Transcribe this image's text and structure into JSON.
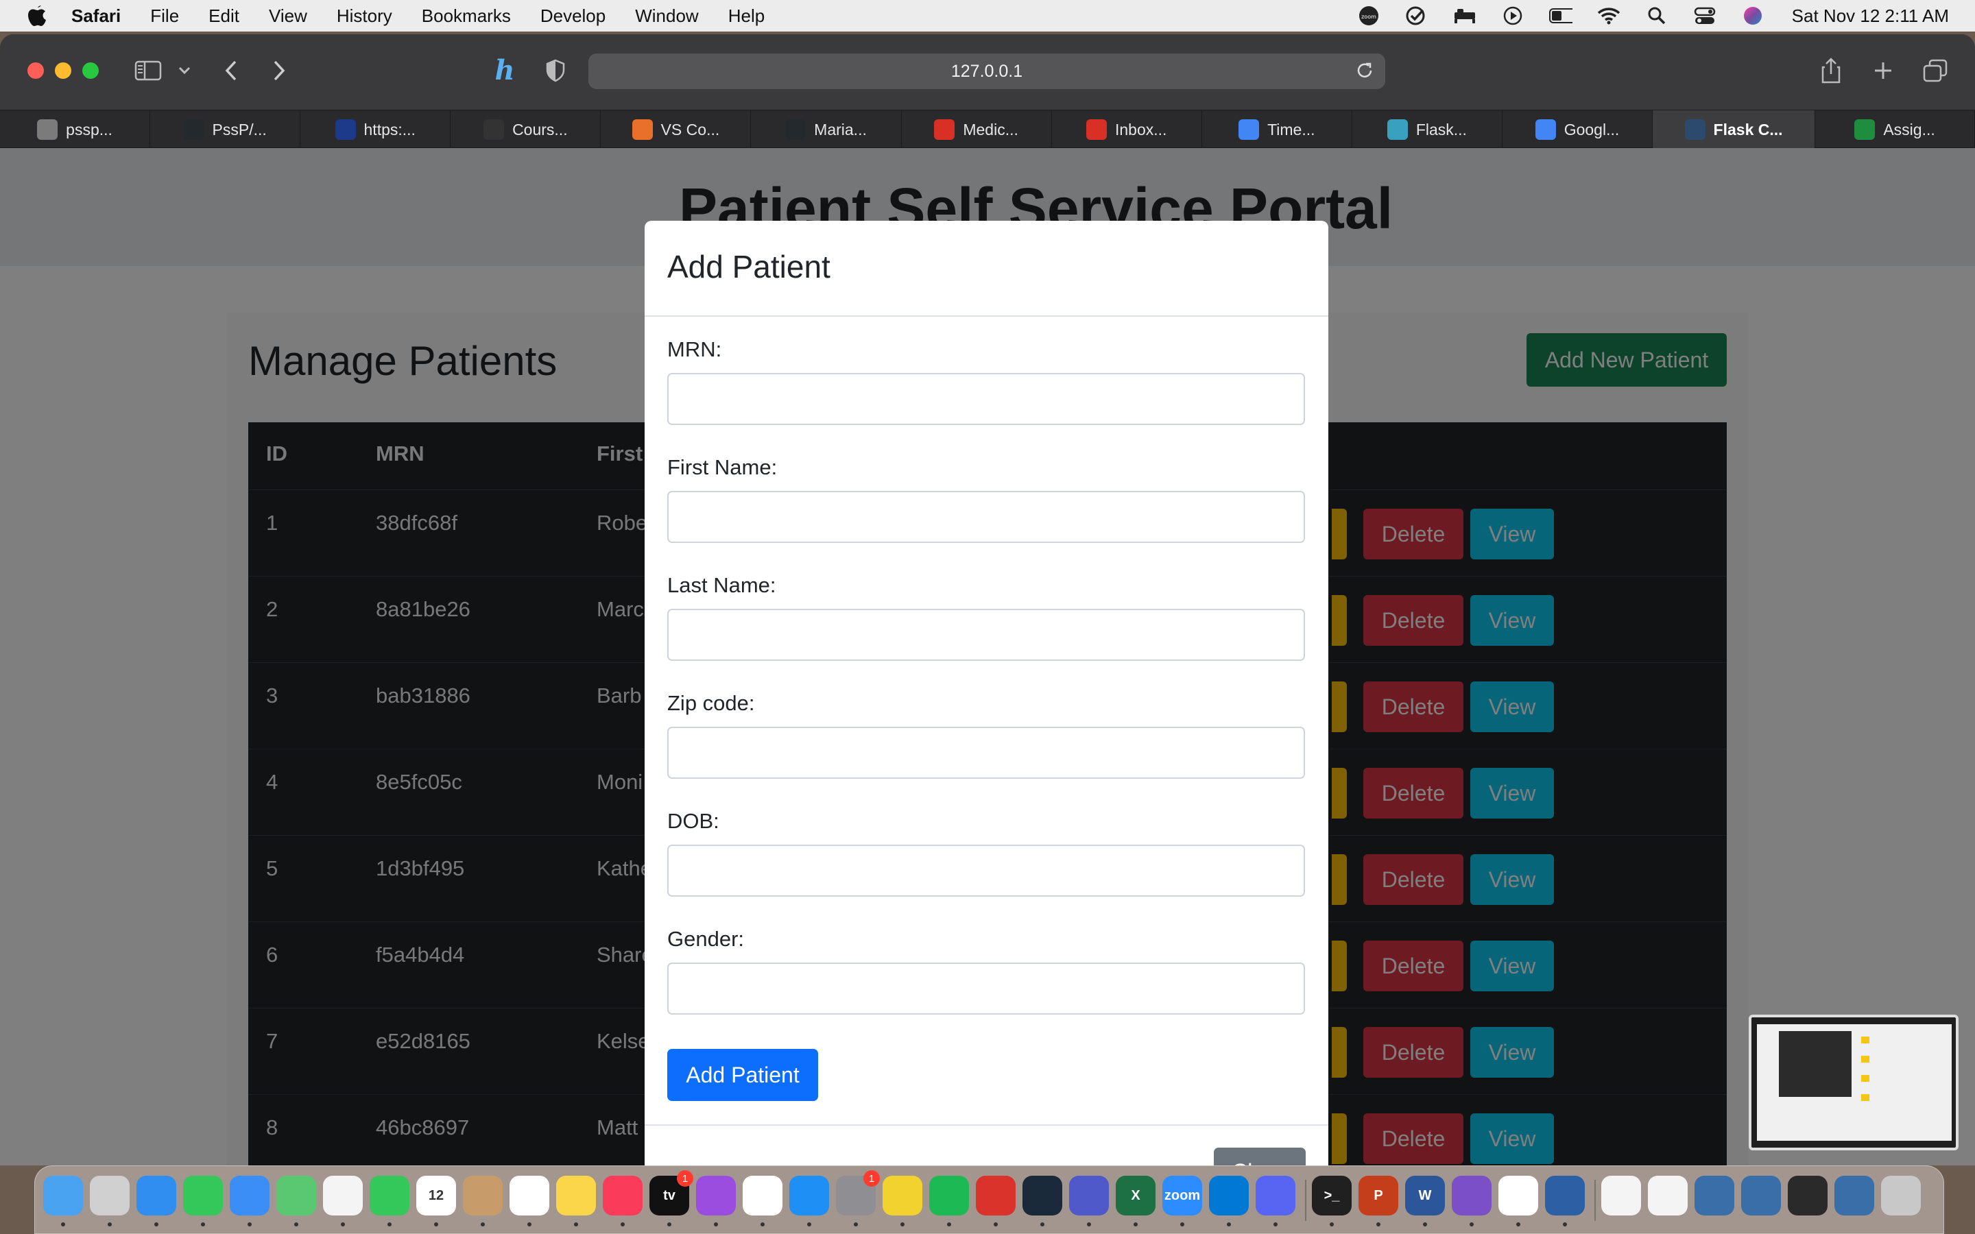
{
  "menubar": {
    "app_name": "Safari",
    "items": [
      "File",
      "Edit",
      "View",
      "History",
      "Bookmarks",
      "Develop",
      "Window",
      "Help"
    ],
    "clock": "Sat Nov 12  2:11 AM",
    "status_icons": [
      "zoom-icon",
      "checkmark-app-icon",
      "bed-icon",
      "play-circle-icon",
      "battery-icon",
      "wifi-icon",
      "search-icon",
      "control-center-icon",
      "siri-icon"
    ]
  },
  "browser": {
    "address": "127.0.0.1",
    "tabs": [
      {
        "label": "pssp...",
        "favicon": "chrome-icon",
        "color": "#7b7b7b"
      },
      {
        "label": "PssP/...",
        "favicon": "github-icon",
        "color": "#24292e"
      },
      {
        "label": "https:...",
        "favicon": "cuny-icon",
        "color": "#1d3a8a"
      },
      {
        "label": "Cours...",
        "favicon": "blackboard-icon",
        "color": "#333333"
      },
      {
        "label": "VS Co...",
        "favicon": "flame-icon",
        "color": "#e8702a"
      },
      {
        "label": "Maria...",
        "favicon": "github-icon",
        "color": "#24292e"
      },
      {
        "label": "Medic...",
        "favicon": "gmail-icon",
        "color": "#d93025"
      },
      {
        "label": "Inbox...",
        "favicon": "gmail-icon",
        "color": "#d93025"
      },
      {
        "label": "Time...",
        "favicon": "google-docs-icon",
        "color": "#4285f4"
      },
      {
        "label": "Flask...",
        "favicon": "flask-icon",
        "color": "#3aa0c0"
      },
      {
        "label": "Googl...",
        "favicon": "google-docs-icon",
        "color": "#4285f4"
      },
      {
        "label": "Flask C...",
        "favicon": "terminal-icon",
        "color": "#2c4a6e"
      },
      {
        "label": "Assig...",
        "favicon": "classroom-icon",
        "color": "#1e8e3e"
      }
    ],
    "active_tab_index": 11
  },
  "page": {
    "big_title": "Patient Self Service Portal",
    "manage_title": "Manage Patients",
    "add_new_label": "Add New Patient",
    "table": {
      "headers": [
        "ID",
        "MRN",
        "First"
      ],
      "rows": [
        {
          "id": "1",
          "mrn": "38dfc68f",
          "first": "Robe"
        },
        {
          "id": "2",
          "mrn": "8a81be26",
          "first": "Marc"
        },
        {
          "id": "3",
          "mrn": "bab31886",
          "first": "Barb"
        },
        {
          "id": "4",
          "mrn": "8e5fc05c",
          "first": "Moni"
        },
        {
          "id": "5",
          "mrn": "1d3bf495",
          "first": "Kathe"
        },
        {
          "id": "6",
          "mrn": "f5a4b4d4",
          "first": "Share"
        },
        {
          "id": "7",
          "mrn": "e52d8165",
          "first": "Kelse"
        },
        {
          "id": "8",
          "mrn": "46bc8697",
          "first": "Matt"
        }
      ],
      "delete_label": "Delete",
      "view_label": "View"
    }
  },
  "modal": {
    "title": "Add Patient",
    "fields": [
      {
        "label": "MRN:",
        "value": ""
      },
      {
        "label": "First Name:",
        "value": ""
      },
      {
        "label": "Last Name:",
        "value": ""
      },
      {
        "label": "Zip code:",
        "value": ""
      },
      {
        "label": "DOB:",
        "value": ""
      },
      {
        "label": "Gender:",
        "value": ""
      }
    ],
    "submit_label": "Add Patient",
    "close_label": "Close"
  },
  "dock": {
    "apps": [
      {
        "name": "finder-icon",
        "color": "#4aa3f0",
        "text": ""
      },
      {
        "name": "launchpad-icon",
        "color": "#d0d0d0",
        "text": ""
      },
      {
        "name": "safari-icon",
        "color": "#2f8ef0",
        "text": ""
      },
      {
        "name": "messages-icon",
        "color": "#34c759",
        "text": ""
      },
      {
        "name": "mail-icon",
        "color": "#3a8ef6",
        "text": ""
      },
      {
        "name": "maps-icon",
        "color": "#5ac870",
        "text": ""
      },
      {
        "name": "photos-icon",
        "color": "#f4f4f4",
        "text": ""
      },
      {
        "name": "facetime-icon",
        "color": "#34c759",
        "text": ""
      },
      {
        "name": "calendar-icon",
        "color": "#ffffff",
        "text": "12"
      },
      {
        "name": "contacts-icon",
        "color": "#c89c6a",
        "text": ""
      },
      {
        "name": "reminders-icon",
        "color": "#ffffff",
        "text": ""
      },
      {
        "name": "notes-icon",
        "color": "#fbd54a",
        "text": ""
      },
      {
        "name": "music-icon",
        "color": "#fa3c5a",
        "text": ""
      },
      {
        "name": "tv-icon",
        "color": "#111111",
        "text": "tv"
      },
      {
        "name": "podcasts-icon",
        "color": "#9b4de0",
        "text": ""
      },
      {
        "name": "news-icon",
        "color": "#ffffff",
        "text": ""
      },
      {
        "name": "app-store-icon",
        "color": "#1e90f5",
        "text": ""
      },
      {
        "name": "system-preferences-icon",
        "color": "#8e8e93",
        "text": ""
      },
      {
        "name": "todo-icon",
        "color": "#f2d22e",
        "text": ""
      },
      {
        "name": "spotify-icon",
        "color": "#1db954",
        "text": ""
      },
      {
        "name": "pdf-app-icon",
        "color": "#d9332c",
        "text": ""
      },
      {
        "name": "kindle-icon",
        "color": "#1a2a3a",
        "text": ""
      },
      {
        "name": "teams-icon",
        "color": "#5059c9",
        "text": ""
      },
      {
        "name": "excel-icon",
        "color": "#1d7044",
        "text": "X"
      },
      {
        "name": "zoom-icon",
        "color": "#2d8cff",
        "text": "zoom"
      },
      {
        "name": "vscode-icon",
        "color": "#0078d4",
        "text": ""
      },
      {
        "name": "discord-icon",
        "color": "#5865f2",
        "text": ""
      },
      {
        "name": "terminal-icon",
        "color": "#202020",
        "text": ">_"
      },
      {
        "name": "powerpoint-icon",
        "color": "#c43e1c",
        "text": "P"
      },
      {
        "name": "word-icon",
        "color": "#2b579a",
        "text": "W"
      },
      {
        "name": "github-desktop-icon",
        "color": "#7b4fc8",
        "text": ""
      },
      {
        "name": "chrome-icon",
        "color": "#ffffff",
        "text": ""
      },
      {
        "name": "mysql-workbench-icon",
        "color": "#2c5fa3",
        "text": ""
      },
      {
        "name": "document-icon",
        "color": "#f4f4f4",
        "text": ""
      },
      {
        "name": "document-icon",
        "color": "#f4f4f4",
        "text": ""
      },
      {
        "name": "vscode-window-icon",
        "color": "#3a6ea8",
        "text": ""
      },
      {
        "name": "vscode-window-icon",
        "color": "#3a6ea8",
        "text": ""
      },
      {
        "name": "window-thumbnail-icon",
        "color": "#2a2a2a",
        "text": ""
      },
      {
        "name": "vscode-window-icon",
        "color": "#3a6ea8",
        "text": ""
      },
      {
        "name": "trash-icon",
        "color": "#c8c8c8",
        "text": ""
      }
    ],
    "badges": {
      "tv-icon": "1",
      "system-preferences-icon": "1"
    }
  }
}
